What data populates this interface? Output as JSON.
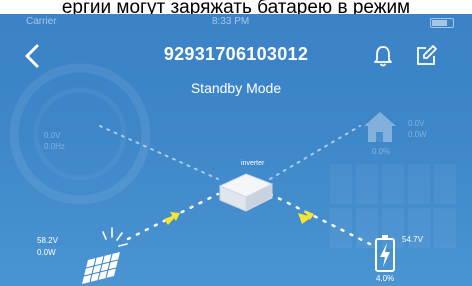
{
  "caption": "ергии могут заряжать батарею в режим",
  "status_bar": {
    "carrier": "Carrier",
    "time": "8:33 PM"
  },
  "header": {
    "title": "92931706103012",
    "mode": "Standby Mode"
  },
  "inverter": {
    "label": "inverter"
  },
  "grid": {
    "voltage": "0.0V",
    "frequency": "0.0Hz"
  },
  "load": {
    "voltage": "0.0V",
    "power": "0.0W",
    "percent": "0.0%"
  },
  "solar": {
    "voltage": "58.2V",
    "power": "0.0W"
  },
  "battery": {
    "voltage": "54.7V",
    "percent": "4.0%"
  },
  "colors": {
    "background": "#3d86c8",
    "accent_yellow": "#f5e431",
    "white": "#ffffff"
  }
}
